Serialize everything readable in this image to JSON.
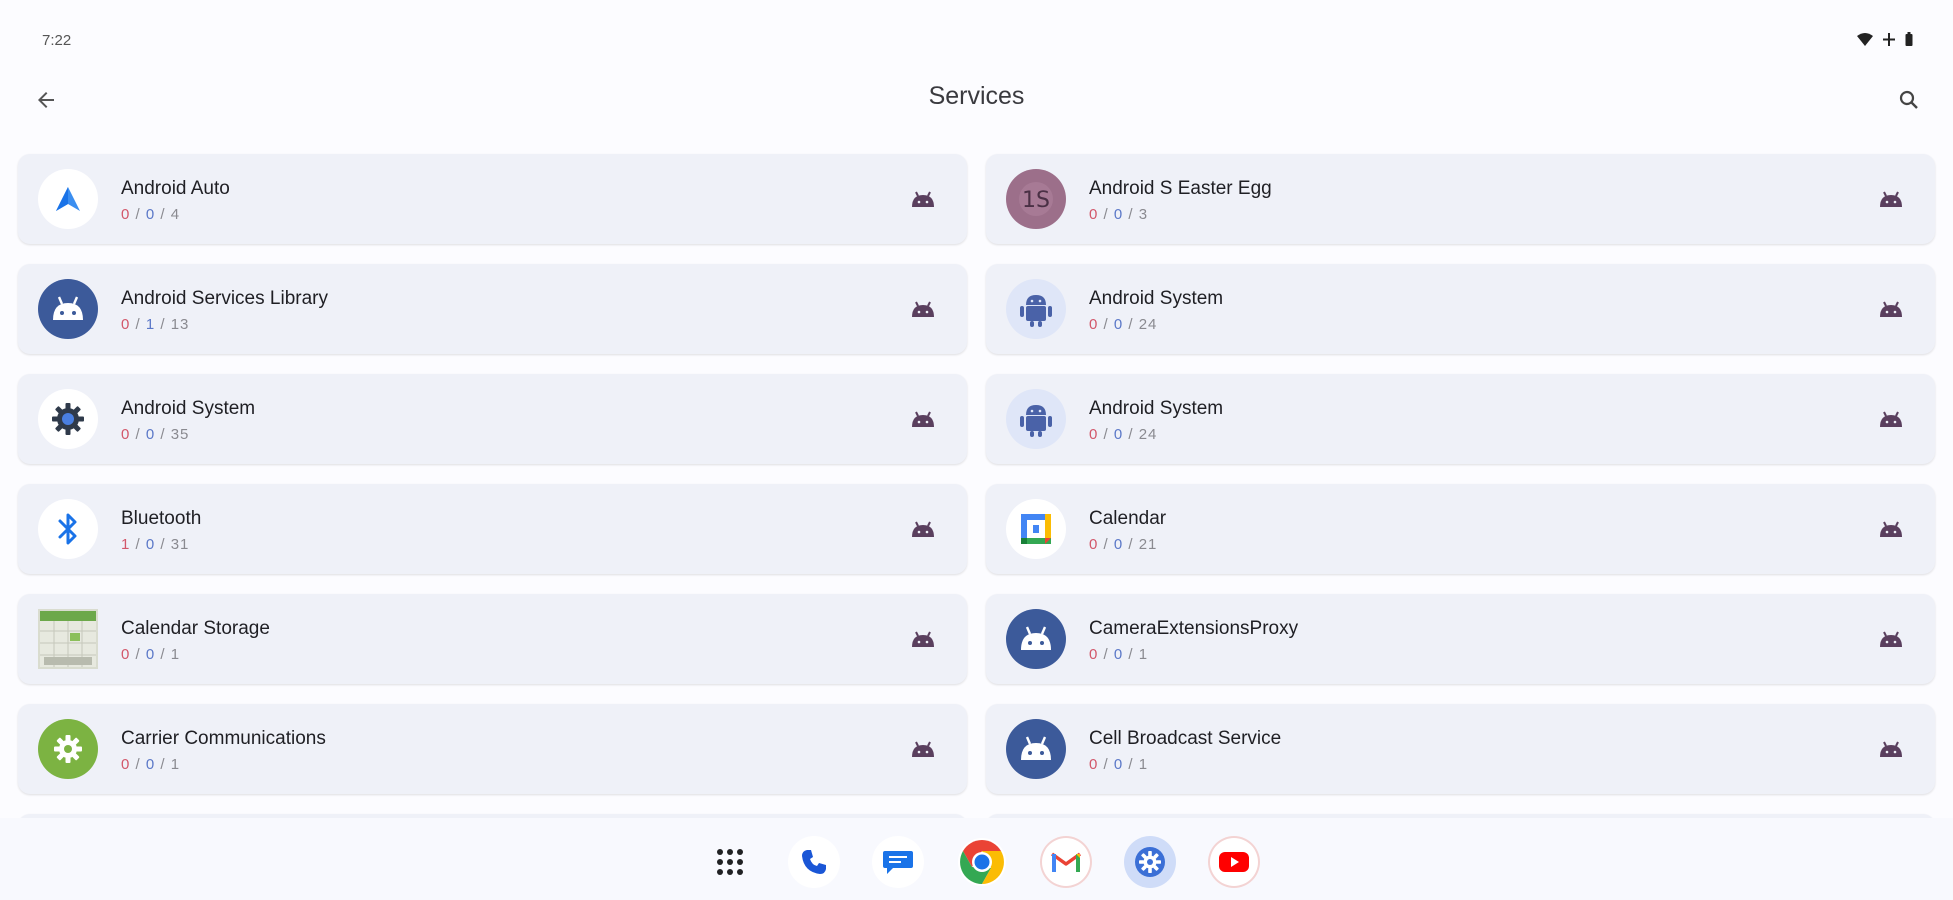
{
  "status_bar": {
    "time": "7:22",
    "icons": [
      "wifi-icon",
      "signal-icon",
      "battery-icon"
    ]
  },
  "app_bar": {
    "title": "Services",
    "back_icon": "arrow-back-icon",
    "search_icon": "search-icon"
  },
  "apps": [
    {
      "name": "Android Auto",
      "icon": "android-auto-icon",
      "counts": [
        "0",
        "0",
        "4"
      ],
      "count_colors": [
        "red",
        "blue",
        "gray"
      ]
    },
    {
      "name": "Android S Easter Egg",
      "icon": "easter-egg-icon",
      "counts": [
        "0",
        "0",
        "3"
      ],
      "count_colors": [
        "red",
        "blue",
        "gray"
      ]
    },
    {
      "name": "Android Services Library",
      "icon": "android-robot-icon",
      "counts": [
        "0",
        "1",
        "13"
      ],
      "count_colors": [
        "red",
        "blue",
        "gray"
      ]
    },
    {
      "name": "Android System",
      "icon": "android-system-icon",
      "counts": [
        "0",
        "0",
        "24"
      ],
      "count_colors": [
        "red",
        "blue",
        "gray"
      ]
    },
    {
      "name": "Android System",
      "icon": "settings-gear-icon",
      "counts": [
        "0",
        "0",
        "35"
      ],
      "count_colors": [
        "red",
        "blue",
        "gray"
      ]
    },
    {
      "name": "Android System",
      "icon": "android-system-icon",
      "counts": [
        "0",
        "0",
        "24"
      ],
      "count_colors": [
        "red",
        "blue",
        "gray"
      ]
    },
    {
      "name": "Bluetooth",
      "icon": "bluetooth-icon",
      "counts": [
        "1",
        "0",
        "31"
      ],
      "count_colors": [
        "red",
        "blue",
        "gray"
      ]
    },
    {
      "name": "Calendar",
      "icon": "calendar-icon",
      "counts": [
        "0",
        "0",
        "21"
      ],
      "count_colors": [
        "red",
        "blue",
        "gray"
      ]
    },
    {
      "name": "Calendar Storage",
      "icon": "calendar-storage-icon",
      "counts": [
        "0",
        "0",
        "1"
      ],
      "count_colors": [
        "red",
        "blue",
        "gray"
      ]
    },
    {
      "name": "CameraExtensionsProxy",
      "icon": "android-robot-icon",
      "counts": [
        "0",
        "0",
        "1"
      ],
      "count_colors": [
        "red",
        "blue",
        "gray"
      ]
    },
    {
      "name": "Carrier Communications",
      "icon": "carrier-gear-icon",
      "counts": [
        "0",
        "0",
        "1"
      ],
      "count_colors": [
        "red",
        "blue",
        "gray"
      ]
    },
    {
      "name": "Cell Broadcast Service",
      "icon": "android-robot-icon",
      "counts": [
        "0",
        "0",
        "1"
      ],
      "count_colors": [
        "red",
        "blue",
        "gray"
      ]
    }
  ],
  "dock": {
    "items": [
      "app-drawer-icon",
      "phone-icon",
      "messages-icon",
      "chrome-icon",
      "gmail-icon",
      "settings-icon",
      "youtube-icon"
    ]
  },
  "colors": {
    "accent_red": "#d2576a",
    "accent_blue": "#5b78c8",
    "card_bg": "#eff1f8",
    "badge": "#5a3f5e"
  }
}
